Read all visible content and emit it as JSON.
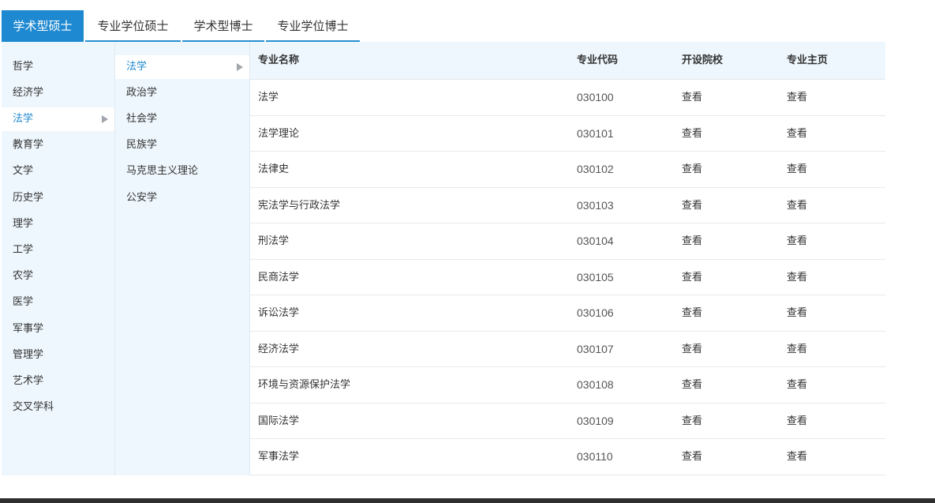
{
  "tabs": [
    {
      "label": "学术型硕士",
      "active": true
    },
    {
      "label": "专业学位硕士",
      "active": false
    },
    {
      "label": "学术型博士",
      "active": false
    },
    {
      "label": "专业学位博士",
      "active": false
    }
  ],
  "categories": [
    "哲学",
    "经济学",
    "法学",
    "教育学",
    "文学",
    "历史学",
    "理学",
    "工学",
    "农学",
    "医学",
    "军事学",
    "管理学",
    "艺术学",
    "交叉学科"
  ],
  "selected_category": "法学",
  "subcategories": [
    "法学",
    "政治学",
    "社会学",
    "民族学",
    "马克思主义理论",
    "公安学"
  ],
  "selected_subcategory": "法学",
  "table": {
    "headers": {
      "name": "专业名称",
      "code": "专业代码",
      "school": "开设院校",
      "home": "专业主页"
    },
    "rows": [
      {
        "name": "法学",
        "code": "030100",
        "school": "查看",
        "home": "查看"
      },
      {
        "name": "法学理论",
        "code": "030101",
        "school": "查看",
        "home": "查看"
      },
      {
        "name": "法律史",
        "code": "030102",
        "school": "查看",
        "home": "查看"
      },
      {
        "name": "宪法学与行政法学",
        "code": "030103",
        "school": "查看",
        "home": "查看"
      },
      {
        "name": "刑法学",
        "code": "030104",
        "school": "查看",
        "home": "查看"
      },
      {
        "name": "民商法学",
        "code": "030105",
        "school": "查看",
        "home": "查看"
      },
      {
        "name": "诉讼法学",
        "code": "030106",
        "school": "查看",
        "home": "查看"
      },
      {
        "name": "经济法学",
        "code": "030107",
        "school": "查看",
        "home": "查看"
      },
      {
        "name": "环境与资源保护法学",
        "code": "030108",
        "school": "查看",
        "home": "查看"
      },
      {
        "name": "国际法学",
        "code": "030109",
        "school": "查看",
        "home": "查看"
      },
      {
        "name": "军事法学",
        "code": "030110",
        "school": "查看",
        "home": "查看"
      }
    ]
  },
  "colors": {
    "accent": "#1e88d0",
    "panel_bg": "#eef7fd"
  }
}
